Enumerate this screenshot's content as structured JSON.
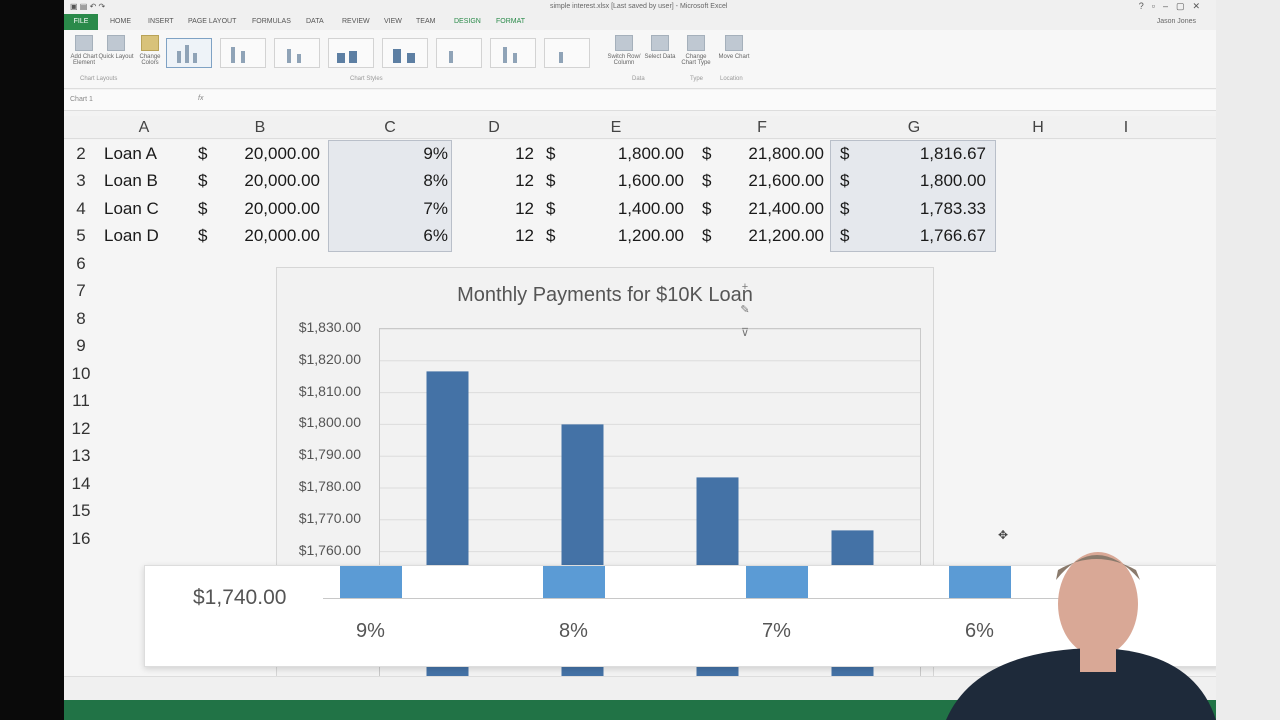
{
  "window": {
    "title": "simple interest.xlsx [Last saved by user] - Microsoft Excel",
    "user": "Jason Jones"
  },
  "ribbon": {
    "tabs": [
      "FILE",
      "HOME",
      "INSERT",
      "PAGE LAYOUT",
      "FORMULAS",
      "DATA",
      "REVIEW",
      "VIEW",
      "TEAM",
      "DESIGN",
      "FORMAT"
    ],
    "buttons": {
      "add_chart_element": "Add Chart Element",
      "quick_layout": "Quick Layout",
      "change_colors": "Change Colors",
      "switch_row_column": "Switch Row/ Column",
      "select_data": "Select Data",
      "change_chart_type": "Change Chart Type",
      "move_chart": "Move Chart"
    },
    "groups": {
      "chart_layouts": "Chart Layouts",
      "chart_styles": "Chart Styles",
      "data": "Data",
      "type": "Type",
      "location": "Location"
    }
  },
  "formula_bar": {
    "name_box": "Chart 1",
    "fx": "fx"
  },
  "columns": [
    "A",
    "B",
    "C",
    "D",
    "E",
    "F",
    "G",
    "H",
    "I"
  ],
  "row_numbers": [
    "2",
    "3",
    "4",
    "5",
    "6",
    "7",
    "8",
    "9",
    "10",
    "11",
    "12",
    "13",
    "14",
    "15",
    "16"
  ],
  "rows": [
    {
      "a": "Loan A",
      "b_sym": "$",
      "b": "20,000.00",
      "c": "9%",
      "d": "12",
      "e_sym": "$",
      "e": "1,800.00",
      "f_sym": "$",
      "f": "21,800.00",
      "g_sym": "$",
      "g": "1,816.67"
    },
    {
      "a": "Loan B",
      "b_sym": "$",
      "b": "20,000.00",
      "c": "8%",
      "d": "12",
      "e_sym": "$",
      "e": "1,600.00",
      "f_sym": "$",
      "f": "21,600.00",
      "g_sym": "$",
      "g": "1,800.00"
    },
    {
      "a": "Loan C",
      "b_sym": "$",
      "b": "20,000.00",
      "c": "7%",
      "d": "12",
      "e_sym": "$",
      "e": "1,400.00",
      "f_sym": "$",
      "f": "21,400.00",
      "g_sym": "$",
      "g": "1,783.33"
    },
    {
      "a": "Loan D",
      "b_sym": "$",
      "b": "20,000.00",
      "c": "6%",
      "d": "12",
      "e_sym": "$",
      "e": "1,200.00",
      "f_sym": "$",
      "f": "21,200.00",
      "g_sym": "$",
      "g": "1,766.67"
    }
  ],
  "chart_tools": [
    "+",
    "✎",
    "⊽"
  ],
  "colors": {
    "bar": "#4472a6",
    "bar_zoom": "#5b9bd5",
    "status_green": "#217346"
  },
  "chart_data": {
    "type": "bar",
    "title": "Monthly Payments for $10K Loan",
    "categories": [
      "9%",
      "8%",
      "7%",
      "6%"
    ],
    "values": [
      1816.67,
      1800.0,
      1783.33,
      1766.67
    ],
    "y_tick_labels": [
      "$1,830.00",
      "$1,820.00",
      "$1,810.00",
      "$1,800.00",
      "$1,790.00",
      "$1,780.00",
      "$1,770.00",
      "$1,760.00"
    ],
    "y_tick_values": [
      1830,
      1820,
      1810,
      1800,
      1790,
      1780,
      1770,
      1760
    ],
    "y_min_label": "$1,740.00",
    "ylim": [
      1740,
      1830
    ],
    "grid": true,
    "legend": "none"
  }
}
